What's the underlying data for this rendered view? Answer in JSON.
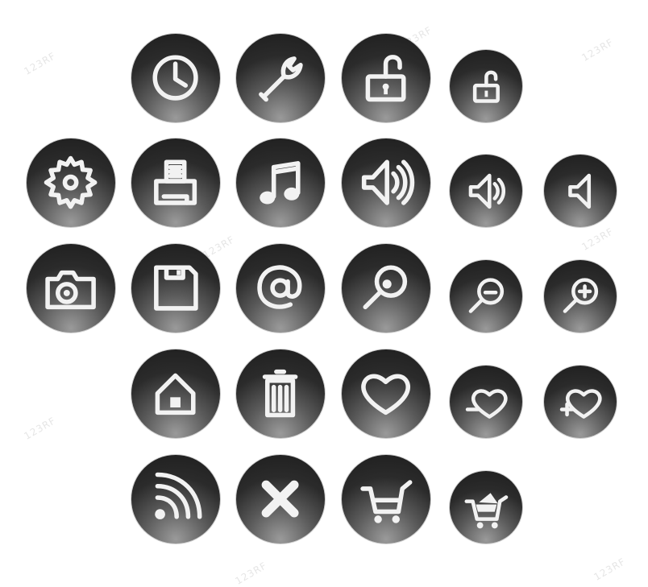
{
  "watermark_text": "123RF",
  "icons": [
    {
      "name": "clock-icon"
    },
    {
      "name": "wrench-icon"
    },
    {
      "name": "unlock-large-icon"
    },
    {
      "name": "unlock-small-icon"
    },
    {
      "name": "gear-icon"
    },
    {
      "name": "printer-icon"
    },
    {
      "name": "music-note-icon"
    },
    {
      "name": "speaker-loud-icon"
    },
    {
      "name": "speaker-medium-icon"
    },
    {
      "name": "speaker-mute-icon"
    },
    {
      "name": "camera-icon"
    },
    {
      "name": "floppy-disk-icon"
    },
    {
      "name": "at-sign-icon"
    },
    {
      "name": "magnifier-icon"
    },
    {
      "name": "zoom-out-icon"
    },
    {
      "name": "zoom-in-icon"
    },
    {
      "name": "home-icon"
    },
    {
      "name": "trash-icon"
    },
    {
      "name": "heart-icon"
    },
    {
      "name": "heart-minus-icon"
    },
    {
      "name": "heart-plus-icon"
    },
    {
      "name": "rss-feed-icon"
    },
    {
      "name": "close-x-icon"
    },
    {
      "name": "shopping-cart-icon"
    },
    {
      "name": "shopping-cart-full-icon"
    }
  ]
}
